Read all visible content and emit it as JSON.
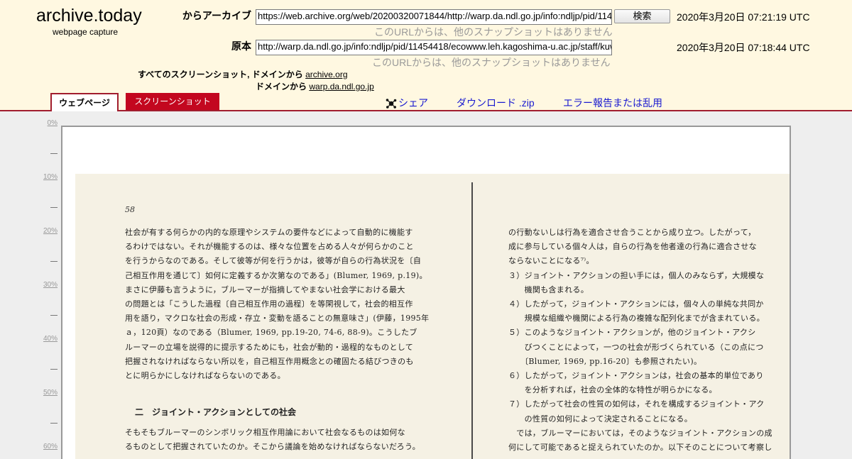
{
  "logo": {
    "title": "archive.today",
    "subtitle": "webpage capture"
  },
  "archive_row": {
    "label": "からアーカイブ",
    "url": "https://web.archive.org/web/20200320071844/http://warp.da.ndl.go.jp/info:ndljp/pid/11454418/ecowww.leh.kagoshima-u.ac.jp/staff/kuwabara/Jpn/ronbun/kazuki_tamura.pdf",
    "search_label": "検索",
    "date": "2020年3月20日 07:21:19 UTC",
    "no_snapshots": "このURLからは、他のスナップショットはありません"
  },
  "original_row": {
    "label": "原本",
    "url": "http://warp.da.ndl.go.jp/info:ndljp/pid/11454418/ecowww.leh.kagoshima-u.ac.jp/staff/kuwabara/Jpn/ronbun/kazuki_tamura.pdf",
    "date": "2020年3月20日 07:18:44 UTC",
    "no_snapshots": "このURLからは、他のスナップショットはありません"
  },
  "screenshots": {
    "all_label": "すべてのスクリーンショット,",
    "domain_label_1": "ドメインから",
    "domain_link_1": "archive.org",
    "domain_label_2": "ドメインから",
    "domain_link_2": "warp.da.ndl.go.jp"
  },
  "tabs": {
    "webpage": "ウェブページ",
    "screenshot": "スクリーンショット"
  },
  "actions": {
    "share": "シェア",
    "download": "ダウンロード .zip",
    "report": "エラー報告または乱用"
  },
  "ruler": [
    "0%",
    "10%",
    "20%",
    "30%",
    "40%",
    "50%",
    "60%"
  ],
  "document": {
    "page_number": "58",
    "left_lines": [
      "社会が有する何らかの内的な原理やシステムの要件などによって自動的に機能す",
      "るわけではない。それが機能するのは、様々な位置を占める人々が何らかのこと",
      "を行うからなのである。そして彼等が何を行うかは，彼等が自らの行為状況を〔自",
      "己相互作用を通じて〕如何に定義するか次第なのである」(Blumer, 1969, p.19)。",
      "まさに伊藤も言うように，ブルーマーが指摘してやまない社会学における最大",
      "の問題とは「こうした過程〔自己相互作用の過程〕を等閑視して，社会的相互作",
      "用を語り，マクロな社会の形成・存立・変動を語ることの無意味さ」(伊藤，1995年",
      "ａ，120頁）なのである（Blumer, 1969, pp.19-20, 74-6, 88-9)。こうしたブ",
      "ルーマーの立場を説得的に提示するためにも，社会が動的・過程的なものとして",
      "把握されなければならない所以を，自己相互作用概念との確固たる結びつきのも",
      "とに明らかにしなければならないのである。"
    ],
    "heading": "二　ジョイント・アクションとしての社会",
    "left_after": [
      "そもそもブルーマーのシンボリック相互作用論において社会なるものは如何な",
      "るものとして把握されていたのか。そこから議論を始めなければならないだろう。"
    ],
    "right_lines": [
      "の行動ないしは行為を適合させ合うことから成り立つ。したがって，",
      "成に参与している個々人は，自らの行為を他者達の行為に適合させな",
      "ならないことになる⁷⁾。",
      "３）ジョイント・アクションの担い手には，個人のみならず，大規模な",
      "　　機関も含まれる。",
      "４）したがって，ジョイント・アクションには，個々人の単純な共同か",
      "　　規模な組織や機関による行為の複雑な配列化までが含まれている。",
      "５）このようなジョイント・アクションが，他のジョイント・アクシ",
      "　　びつくことによって，一つの社会が形づくられている（この点につ",
      "　　〔Blumer, 1969, pp.16-20〕も参照されたい)。",
      "６）したがって，ジョイント・アクションは，社会の基本的単位であり",
      "　　を分析すれば，社会の全体的な特性が明らかになる。",
      "７）したがって社会の性質の如何は，それを構成するジョイント・アク",
      "　　の性質の如何によって決定されることになる。",
      "　では，ブルーマーにおいては，そのようなジョイント・アクションの成",
      "何にして可能であると捉えられていたのか。以下そのことについて考察し"
    ]
  }
}
